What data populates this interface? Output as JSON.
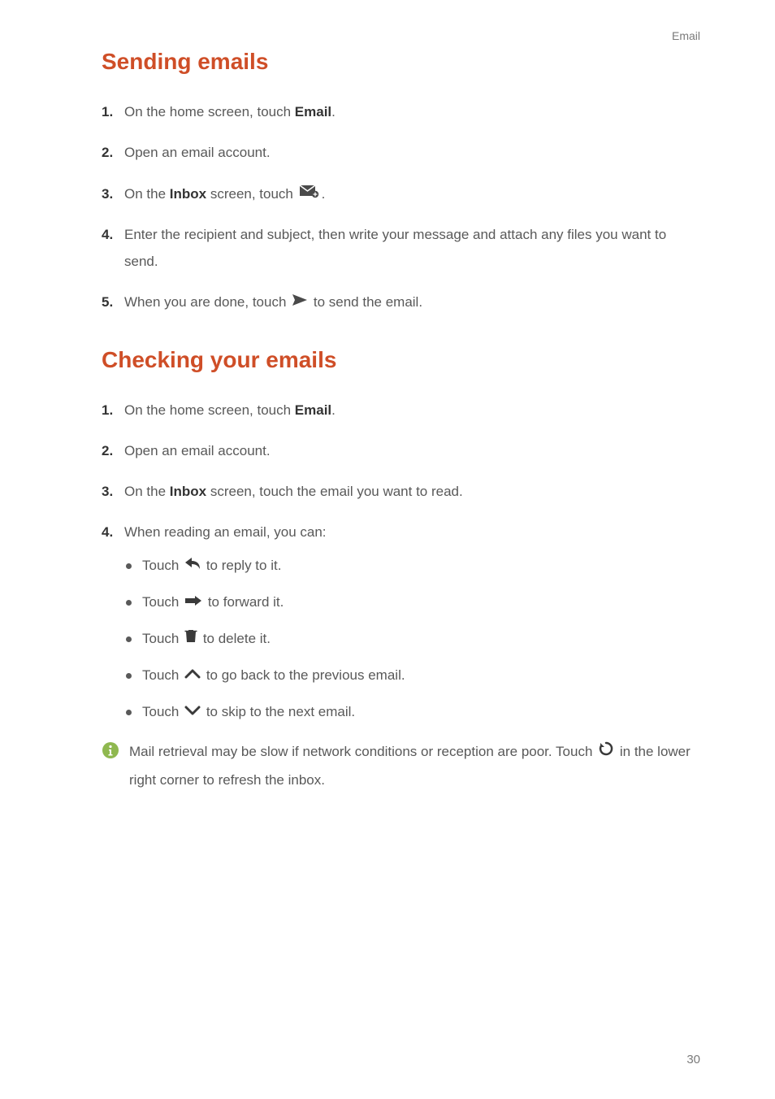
{
  "header": {
    "section_label": "Email"
  },
  "section1": {
    "title": "Sending emails",
    "steps": [
      {
        "pre": "On the home screen, touch ",
        "bold": "Email",
        "post": "."
      },
      {
        "full": "Open an email account."
      },
      {
        "pre": "On the ",
        "bold": "Inbox",
        "mid": " screen, touch ",
        "icon": "compose",
        "post": "."
      },
      {
        "full": "Enter the recipient and subject, then write your message and attach any files you want to send."
      },
      {
        "pre": "When you are done, touch ",
        "icon": "send",
        "post": " to send the email."
      }
    ]
  },
  "section2": {
    "title": "Checking your emails",
    "steps": [
      {
        "pre": "On the home screen, touch ",
        "bold": "Email",
        "post": "."
      },
      {
        "full": "Open an email account."
      },
      {
        "pre": "On the ",
        "bold": "Inbox",
        "post": " screen, touch the email you want to read."
      },
      {
        "full": "When reading an email, you can:"
      }
    ],
    "bullets": [
      {
        "pre": "Touch ",
        "icon": "reply",
        "post": " to reply to it."
      },
      {
        "pre": "Touch ",
        "icon": "forward",
        "post": " to forward it."
      },
      {
        "pre": "Touch ",
        "icon": "trash",
        "post": " to delete it."
      },
      {
        "pre": "Touch ",
        "icon": "up",
        "post": " to go back to the previous email."
      },
      {
        "pre": "Touch ",
        "icon": "down",
        "post": " to skip to the next email."
      }
    ],
    "info": {
      "line1": "Mail retrieval may be slow if network conditions or reception are poor. ",
      "line2_pre": "Touch ",
      "line2_icon": "refresh",
      "line2_post": " in the lower right corner to refresh the inbox."
    }
  },
  "page_number": "30"
}
